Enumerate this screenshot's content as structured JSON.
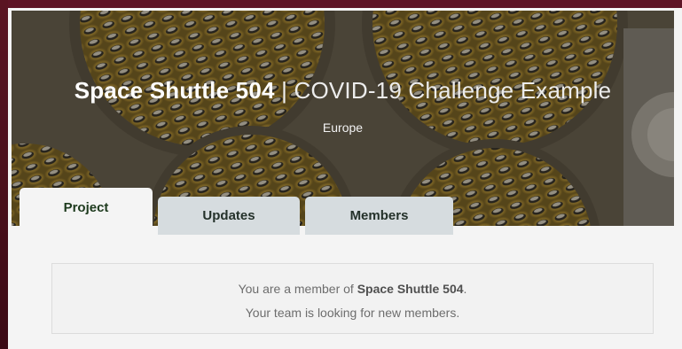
{
  "colors": {
    "page_frame": "#4a0f1c",
    "hero_accent": "#c9a63a",
    "active_tab_text": "#1d3a1d",
    "inactive_tab_bg": "#d6dcdf"
  },
  "hero": {
    "title_strong": "Space Shuttle 504",
    "title_separator": "|",
    "title_rest": "COVID-19 Challenge Example",
    "location": "Europe"
  },
  "tabs": [
    {
      "label": "Project",
      "active": true
    },
    {
      "label": "Updates",
      "active": false
    },
    {
      "label": "Members",
      "active": false
    }
  ],
  "notice": {
    "line1_prefix": "You are a member of ",
    "line1_team": "Space Shuttle 504",
    "line1_suffix": ".",
    "line2": "Your team is looking for new members."
  }
}
